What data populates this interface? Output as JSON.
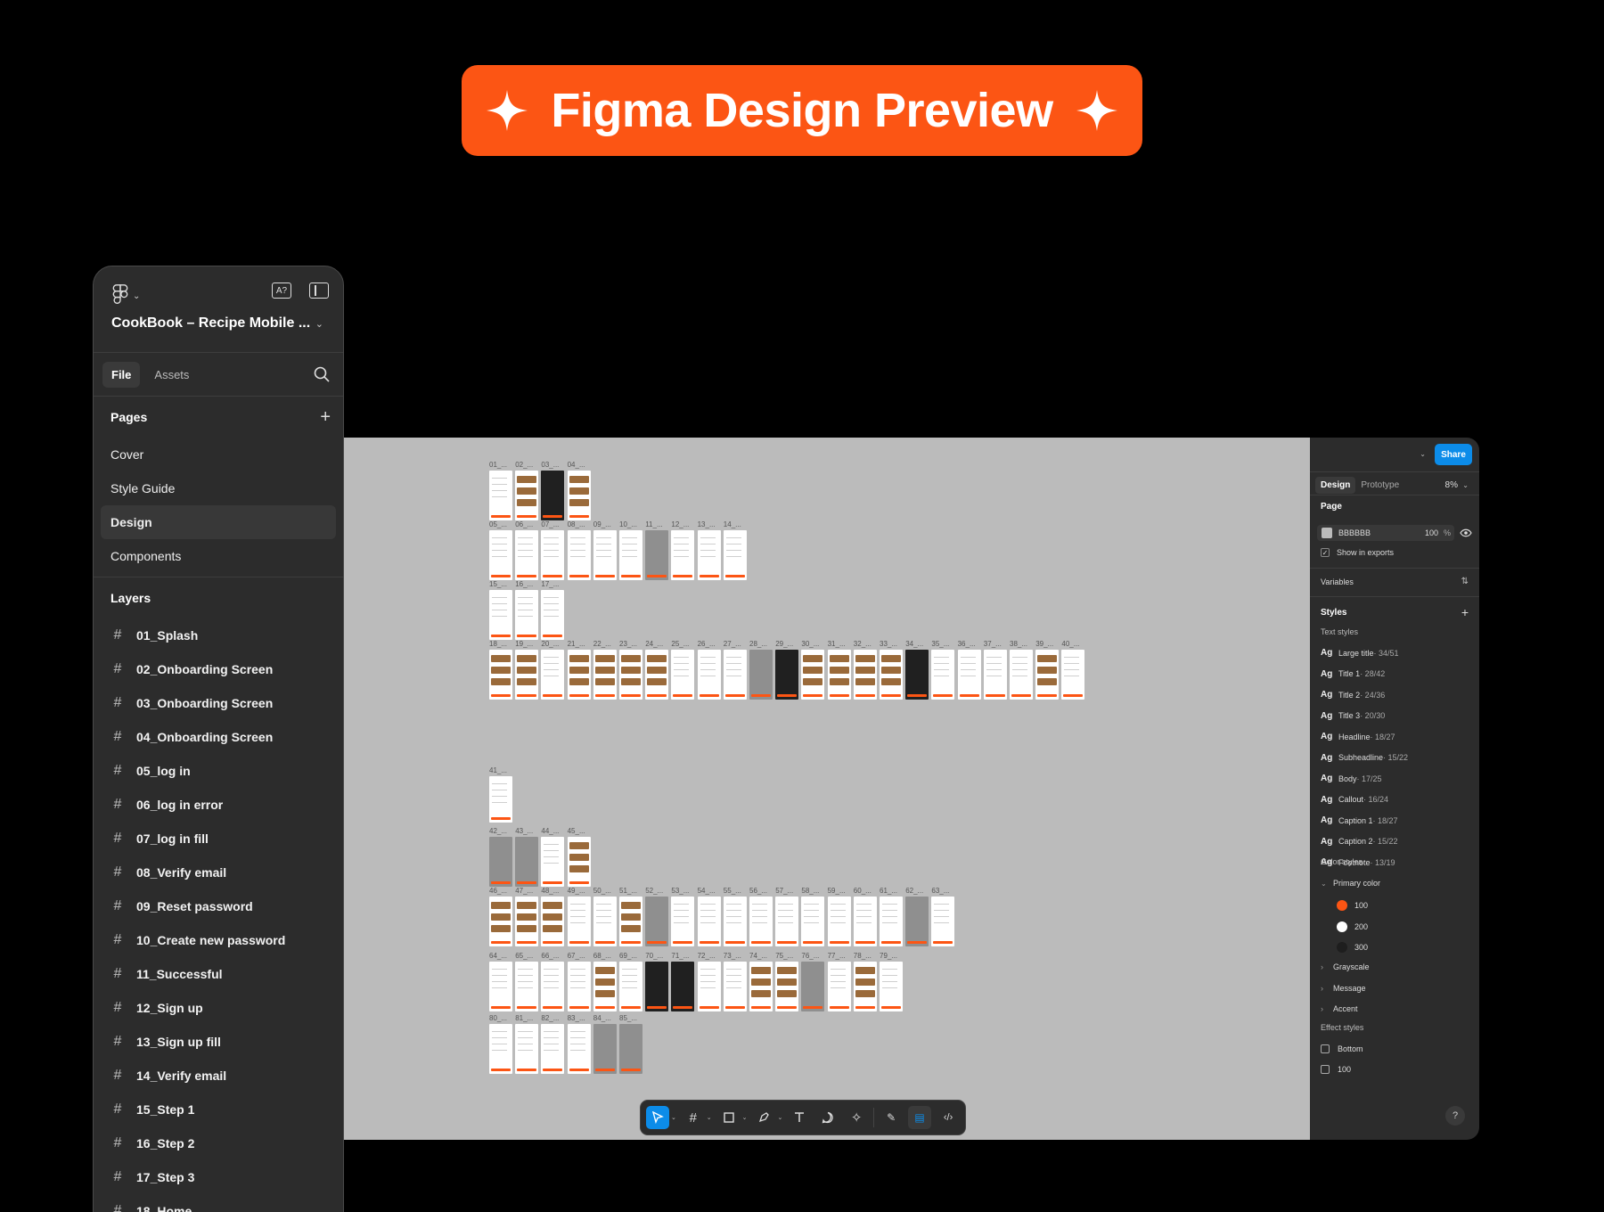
{
  "banner": {
    "title": "Figma Design Preview"
  },
  "left_panel": {
    "file_title": "CookBook – Recipe Mobile ...",
    "tabs": {
      "file": "File",
      "assets": "Assets"
    },
    "pages_header": "Pages",
    "pages": [
      "Cover",
      "Style Guide",
      "Design",
      "Components"
    ],
    "active_page": "Design",
    "layers_header": "Layers",
    "layers": [
      "01_Splash",
      "02_Onboarding Screen",
      "03_Onboarding Screen",
      "04_Onboarding Screen",
      "05_log in",
      "06_log in error",
      "07_log in fill",
      "08_Verify email",
      "09_Reset password",
      "10_Create new password",
      "11_Successful",
      "12_Sign up",
      "13_Sign up fill",
      "14_Verify email",
      "15_Step 1",
      "16_Step 2",
      "17_Step 3",
      "18_Home"
    ]
  },
  "right_panel": {
    "share": "Share",
    "tabs": {
      "design": "Design",
      "prototype": "Prototype"
    },
    "zoom": "8%",
    "page_section": "Page",
    "page_color": "BBBBBB",
    "page_opacity": "100",
    "page_opacity_unit": "%",
    "show_in_exports": "Show in exports",
    "variables": "Variables",
    "styles": "Styles",
    "text_styles_label": "Text styles",
    "text_styles": [
      {
        "name": "Large title",
        "size": " · 34/51"
      },
      {
        "name": "Title 1",
        "size": " · 28/42"
      },
      {
        "name": "Title 2",
        "size": " · 24/36"
      },
      {
        "name": "Title 3",
        "size": " · 20/30"
      },
      {
        "name": "Headline",
        "size": " · 18/27"
      },
      {
        "name": "Subheadline",
        "size": " · 15/22"
      },
      {
        "name": "Body",
        "size": " · 17/25"
      },
      {
        "name": "Callout",
        "size": " · 16/24"
      },
      {
        "name": "Caption 1",
        "size": " · 18/27"
      },
      {
        "name": "Caption 2",
        "size": " · 15/22"
      },
      {
        "name": "Footnote",
        "size": " · 13/19"
      }
    ],
    "ag_glyph": "Ag",
    "color_styles_label": "Color styles",
    "primary_color": "Primary color",
    "primary_shades": [
      {
        "name": "100",
        "color": "#fc5514"
      },
      {
        "name": "200",
        "color": "#ffffff"
      },
      {
        "name": "300",
        "color": "#1e1e1e"
      }
    ],
    "color_groups": [
      "Grayscale",
      "Message",
      "Accent"
    ],
    "effect_styles_label": "Effect styles",
    "effect_styles": [
      "Bottom",
      "100"
    ],
    "help": "?"
  },
  "canvas": {
    "background": "#BBBBBB",
    "frame_labels": [
      "01_...",
      "02_...",
      "03_...",
      "04_...",
      "05_...",
      "06_...",
      "07_...",
      "08_...",
      "09_...",
      "10_...",
      "11_...",
      "12_...",
      "13_...",
      "14_...",
      "15_...",
      "16_...",
      "17_...",
      "18_...",
      "19_...",
      "20_...",
      "21_...",
      "22_...",
      "23_...",
      "24_...",
      "25_...",
      "26_...",
      "27_...",
      "28_...",
      "29_...",
      "30_...",
      "31_...",
      "32_...",
      "33_...",
      "34_...",
      "35_...",
      "36_...",
      "37_...",
      "38_...",
      "39_...",
      "40_...",
      "41_...",
      "42_...",
      "43_...",
      "44_...",
      "45_...",
      "46_...",
      "47_...",
      "48_...",
      "49_...",
      "50_...",
      "51_...",
      "52_...",
      "53_...",
      "54_...",
      "55_...",
      "56_...",
      "57_...",
      "58_...",
      "59_...",
      "60_...",
      "61_...",
      "62_...",
      "63_...",
      "64_...",
      "65_...",
      "66_...",
      "67_...",
      "68_...",
      "69_...",
      "70_...",
      "71_...",
      "72_...",
      "73_...",
      "74_...",
      "75_...",
      "76_...",
      "77_...",
      "78_...",
      "79_...",
      "80_...",
      "81_...",
      "82_...",
      "83_...",
      "84_...",
      "85_..."
    ]
  },
  "colors": {
    "accent": "#fc5514",
    "panel": "#2c2c2c",
    "blue": "#0c8ce9"
  }
}
